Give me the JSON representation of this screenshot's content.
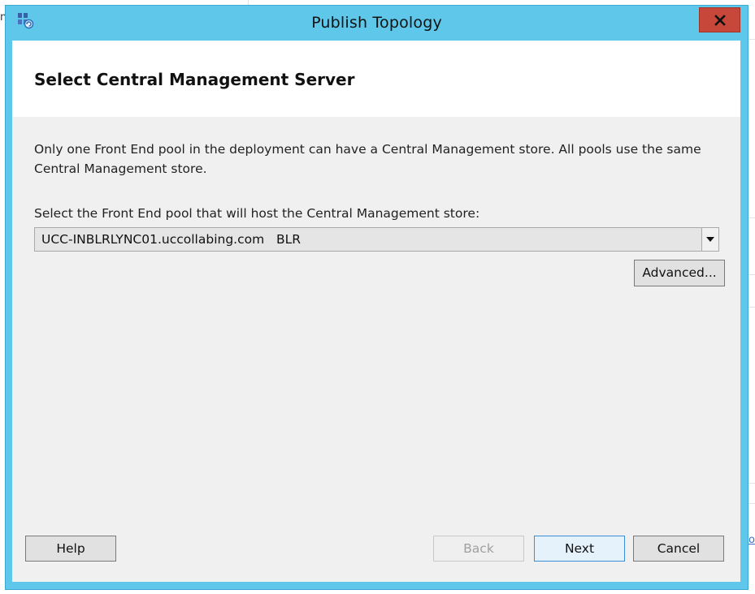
{
  "window": {
    "title": "Publish Topology",
    "icon": "topology-builder-icon",
    "close_icon": "close-icon"
  },
  "page": {
    "heading": "Select Central Management Server",
    "description": "Only one Front End pool in the deployment can have a Central Management store. All pools use the same Central Management store.",
    "pool_label": "Select the Front End pool that will host the Central Management store:",
    "pool_select": {
      "value": "UCC-INBLRLYNC01.uccollabing.com   BLR",
      "arrow_icon": "chevron-down-icon"
    },
    "advanced_label": "Advanced..."
  },
  "footer": {
    "help_label": "Help",
    "back_label": "Back",
    "next_label": "Next",
    "cancel_label": "Cancel"
  },
  "background": {
    "left_edge_text": "n",
    "right_edge_link_text": "o"
  },
  "colors": {
    "frame": "#5ec7ea",
    "close_button": "#c7483a",
    "client_background": "#f0f0f0",
    "header_band": "#ffffff",
    "default_button_border": "#3c8ed6"
  }
}
